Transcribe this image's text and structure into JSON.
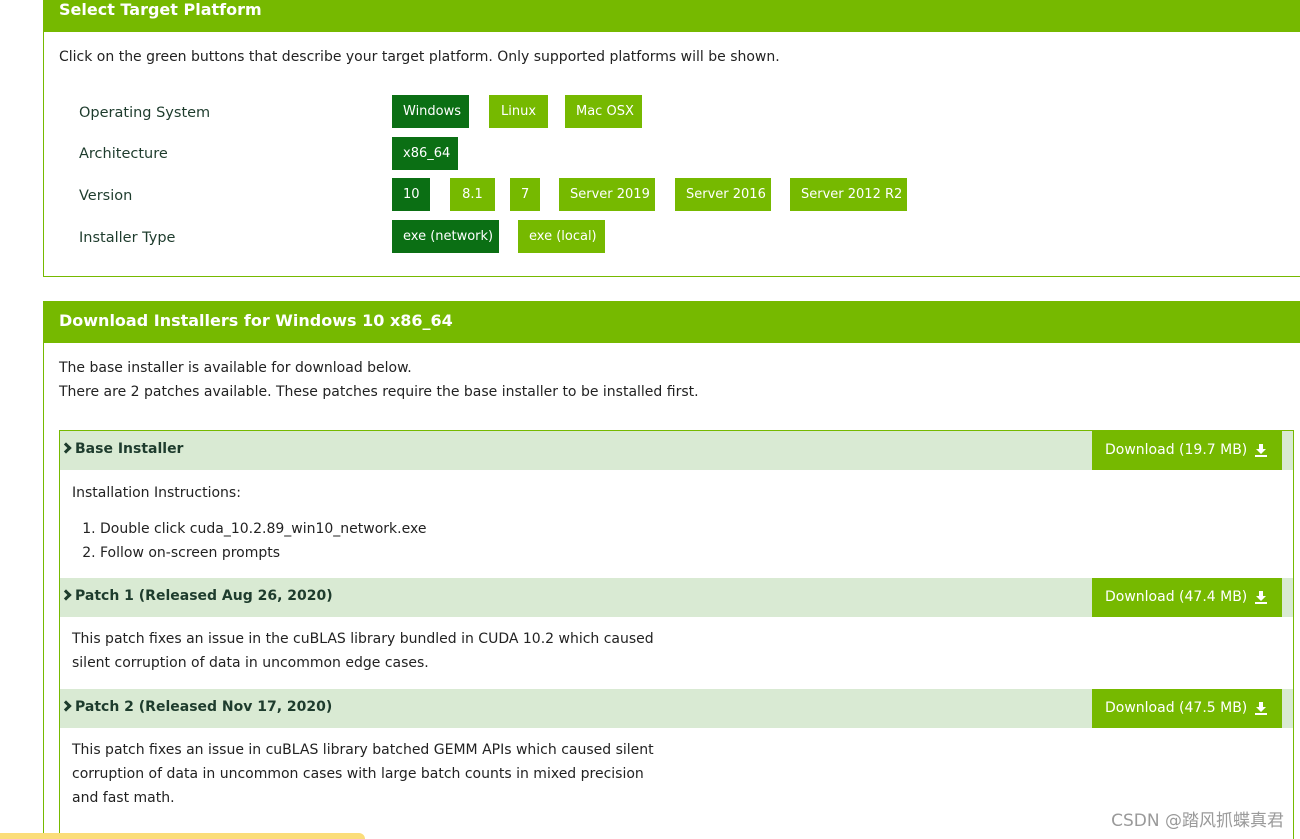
{
  "platform": {
    "title": "Select Target Platform",
    "intro": "Click on the green buttons that describe your target platform. Only supported platforms will be shown.",
    "rows": [
      {
        "label": "Operating System",
        "options": [
          "Windows",
          "Linux",
          "Mac OSX"
        ],
        "selected": "Windows"
      },
      {
        "label": "Architecture",
        "options": [
          "x86_64"
        ],
        "selected": "x86_64"
      },
      {
        "label": "Version",
        "options": [
          "10",
          "8.1",
          "7",
          "Server 2019",
          "Server 2016",
          "Server 2012 R2"
        ],
        "selected": "10"
      },
      {
        "label": "Installer Type",
        "options": [
          "exe (network)",
          "exe (local)"
        ],
        "selected": "exe (network)"
      }
    ]
  },
  "downloads": {
    "title": "Download Installers for Windows 10 x86_64",
    "intro_line1": "The base installer is available for download below.",
    "intro_line2": "There are 2 patches available. These patches require the base installer to be installed first.",
    "items": [
      {
        "title": "Base Installer",
        "button": "Download (19.7 MB)",
        "instructions_title": "Installation Instructions:",
        "steps": [
          "Double click cuda_10.2.89_win10_network.exe",
          "Follow on-screen prompts"
        ]
      },
      {
        "title": "Patch 1 (Released Aug 26, 2020)",
        "button": "Download (47.4 MB)",
        "desc_line1": "This patch fixes an issue in the cuBLAS library bundled in CUDA 10.2 which caused",
        "desc_line2": "silent corruption of data in uncommon edge cases."
      },
      {
        "title": "Patch 2 (Released Nov 17, 2020)",
        "button": "Download (47.5 MB)",
        "desc_line1": "This patch fixes an issue in cuBLAS library batched GEMM APIs which caused silent",
        "desc_line2": "corruption of data in uncommon cases with large batch counts in mixed precision",
        "desc_line3": "and fast math."
      }
    ]
  },
  "watermark": "CSDN @踏风抓蝶真君",
  "icons": {
    "chevron": "chevron-right-icon",
    "download": "download-icon"
  },
  "colors": {
    "accent": "#76b900",
    "selected": "#0b6f14",
    "row_header": "#d9ead3"
  }
}
